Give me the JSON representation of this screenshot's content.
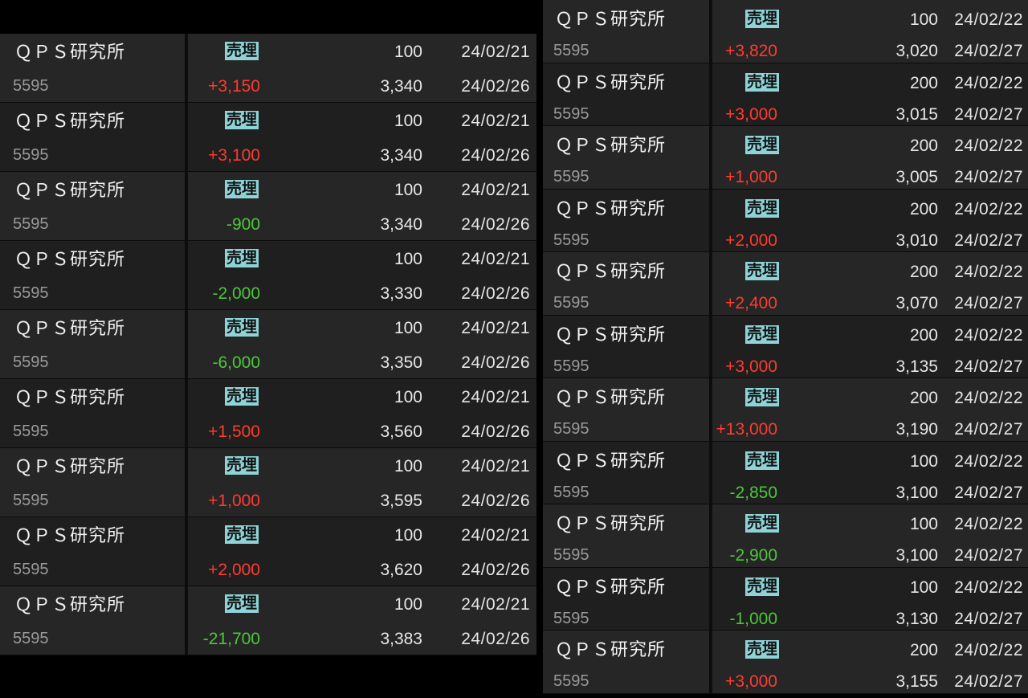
{
  "colors": {
    "positive": "#ff3b30",
    "negative": "#4cc63a",
    "badge_bg": "#8fd3d6"
  },
  "left_rows": [
    {
      "name": "ＱＰＳ研究所",
      "code": "5595",
      "side": "売埋",
      "pl": "+3,150",
      "qty": "100",
      "price": "3,340",
      "open_date": "24/02/21",
      "close_date": "24/02/26"
    },
    {
      "name": "ＱＰＳ研究所",
      "code": "5595",
      "side": "売埋",
      "pl": "+3,100",
      "qty": "100",
      "price": "3,340",
      "open_date": "24/02/21",
      "close_date": "24/02/26"
    },
    {
      "name": "ＱＰＳ研究所",
      "code": "5595",
      "side": "売埋",
      "pl": "-900",
      "qty": "100",
      "price": "3,340",
      "open_date": "24/02/21",
      "close_date": "24/02/26"
    },
    {
      "name": "ＱＰＳ研究所",
      "code": "5595",
      "side": "売埋",
      "pl": "-2,000",
      "qty": "100",
      "price": "3,330",
      "open_date": "24/02/21",
      "close_date": "24/02/26"
    },
    {
      "name": "ＱＰＳ研究所",
      "code": "5595",
      "side": "売埋",
      "pl": "-6,000",
      "qty": "100",
      "price": "3,350",
      "open_date": "24/02/21",
      "close_date": "24/02/26"
    },
    {
      "name": "ＱＰＳ研究所",
      "code": "5595",
      "side": "売埋",
      "pl": "+1,500",
      "qty": "100",
      "price": "3,560",
      "open_date": "24/02/21",
      "close_date": "24/02/26"
    },
    {
      "name": "ＱＰＳ研究所",
      "code": "5595",
      "side": "売埋",
      "pl": "+1,000",
      "qty": "100",
      "price": "3,595",
      "open_date": "24/02/21",
      "close_date": "24/02/26"
    },
    {
      "name": "ＱＰＳ研究所",
      "code": "5595",
      "side": "売埋",
      "pl": "+2,000",
      "qty": "100",
      "price": "3,620",
      "open_date": "24/02/21",
      "close_date": "24/02/26"
    },
    {
      "name": "ＱＰＳ研究所",
      "code": "5595",
      "side": "売埋",
      "pl": "-21,700",
      "qty": "100",
      "price": "3,383",
      "open_date": "24/02/21",
      "close_date": "24/02/26"
    }
  ],
  "right_rows": [
    {
      "name": "ＱＰＳ研究所",
      "code": "5595",
      "side": "売埋",
      "pl": "+3,820",
      "qty": "100",
      "price": "3,020",
      "open_date": "24/02/22",
      "close_date": "24/02/27"
    },
    {
      "name": "ＱＰＳ研究所",
      "code": "5595",
      "side": "売埋",
      "pl": "+3,000",
      "qty": "200",
      "price": "3,015",
      "open_date": "24/02/22",
      "close_date": "24/02/27"
    },
    {
      "name": "ＱＰＳ研究所",
      "code": "5595",
      "side": "売埋",
      "pl": "+1,000",
      "qty": "200",
      "price": "3,005",
      "open_date": "24/02/22",
      "close_date": "24/02/27"
    },
    {
      "name": "ＱＰＳ研究所",
      "code": "5595",
      "side": "売埋",
      "pl": "+2,000",
      "qty": "200",
      "price": "3,010",
      "open_date": "24/02/22",
      "close_date": "24/02/27"
    },
    {
      "name": "ＱＰＳ研究所",
      "code": "5595",
      "side": "売埋",
      "pl": "+2,400",
      "qty": "200",
      "price": "3,070",
      "open_date": "24/02/22",
      "close_date": "24/02/27"
    },
    {
      "name": "ＱＰＳ研究所",
      "code": "5595",
      "side": "売埋",
      "pl": "+3,000",
      "qty": "200",
      "price": "3,135",
      "open_date": "24/02/22",
      "close_date": "24/02/27"
    },
    {
      "name": "ＱＰＳ研究所",
      "code": "5595",
      "side": "売埋",
      "pl": "+13,000",
      "qty": "200",
      "price": "3,190",
      "open_date": "24/02/22",
      "close_date": "24/02/27"
    },
    {
      "name": "ＱＰＳ研究所",
      "code": "5595",
      "side": "売埋",
      "pl": "-2,850",
      "qty": "100",
      "price": "3,100",
      "open_date": "24/02/22",
      "close_date": "24/02/27"
    },
    {
      "name": "ＱＰＳ研究所",
      "code": "5595",
      "side": "売埋",
      "pl": "-2,900",
      "qty": "100",
      "price": "3,100",
      "open_date": "24/02/22",
      "close_date": "24/02/27"
    },
    {
      "name": "ＱＰＳ研究所",
      "code": "5595",
      "side": "売埋",
      "pl": "-1,000",
      "qty": "100",
      "price": "3,130",
      "open_date": "24/02/22",
      "close_date": "24/02/27"
    },
    {
      "name": "ＱＰＳ研究所",
      "code": "5595",
      "side": "売埋",
      "pl": "+3,000",
      "qty": "200",
      "price": "3,155",
      "open_date": "24/02/22",
      "close_date": "24/02/27"
    }
  ]
}
